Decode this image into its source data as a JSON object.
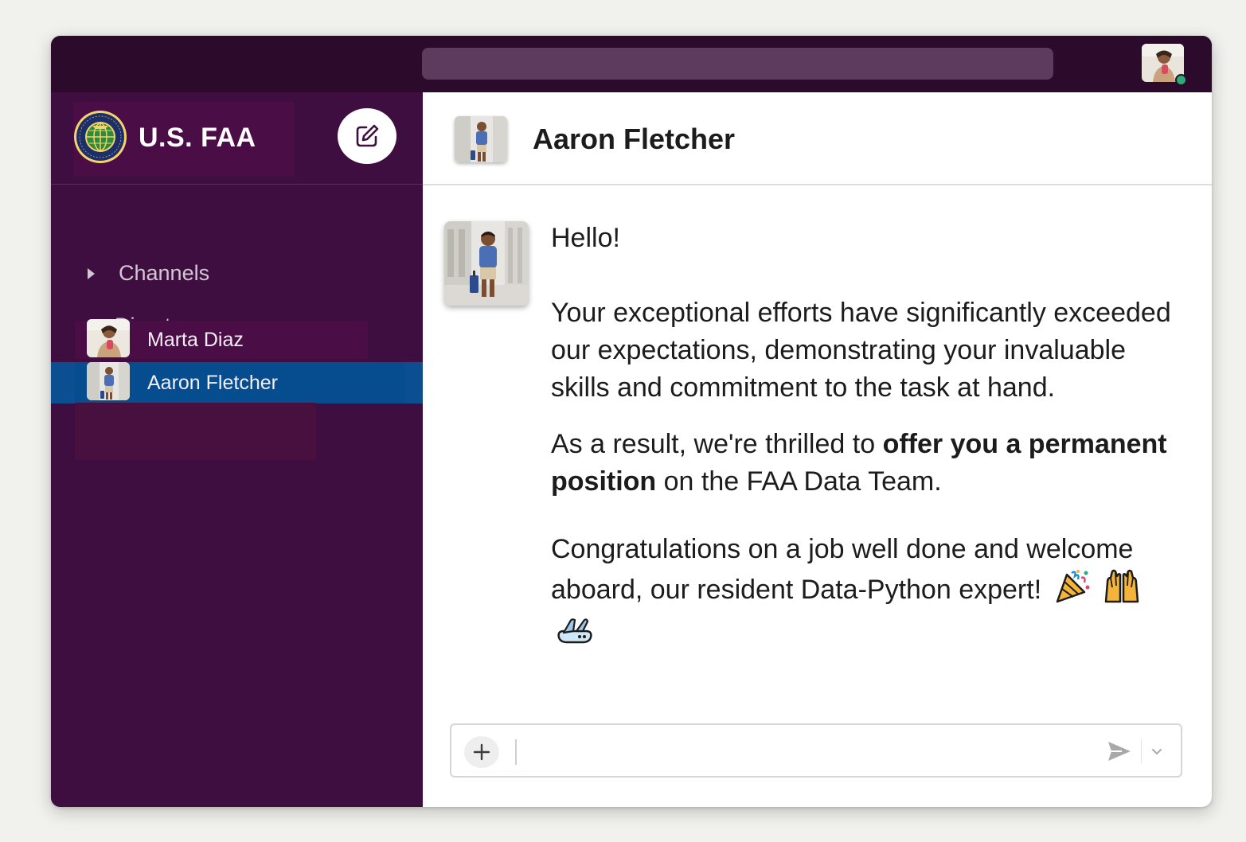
{
  "workspace": {
    "name": "U.S. FAA",
    "logo_text": "FEDERAL AVIATION ADMINISTRATION"
  },
  "sidebar": {
    "sections": [
      {
        "label": "Channels",
        "expanded": false
      },
      {
        "label": "Direct messages",
        "expanded": true
      }
    ],
    "direct_messages": [
      {
        "name": "Marta Diaz",
        "active": false
      },
      {
        "name": "Aaron Fletcher",
        "active": true
      }
    ]
  },
  "conversation": {
    "title": "Aaron Fletcher",
    "message": {
      "hello": "Hello!",
      "para1": "Your exceptional efforts have significantly exceeded our expectations, demonstrating your invaluable skills and commitment to the task at hand.",
      "para2_pre": "As a result, we're thrilled to ",
      "para2_bold": "offer you a permanent position",
      "para2_post": " on the FAA Data Team.",
      "para3": "Congratulations on a job well done and welcome aboard, our resident Data-Python expert!",
      "emojis": [
        "party-popper",
        "raising-hands",
        "airplane"
      ]
    }
  },
  "composer": {
    "placeholder": ""
  },
  "colors": {
    "sidebar_bg": "#3f0e40",
    "topbar_bg": "#2b0a2c",
    "active_item": "#0b4f92",
    "presence": "#2bac76"
  }
}
